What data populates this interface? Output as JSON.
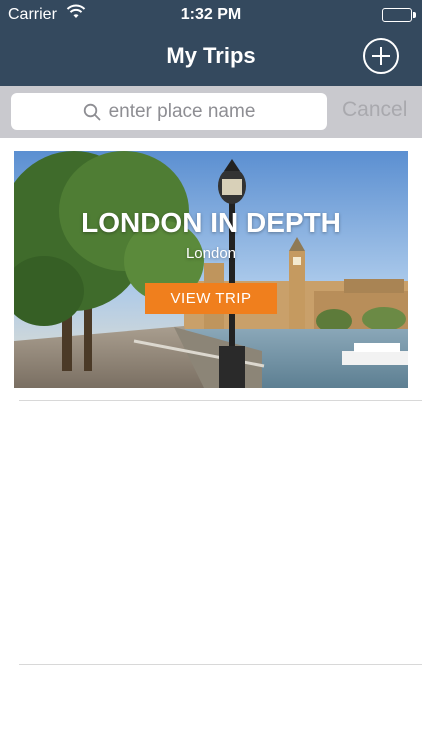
{
  "status_bar": {
    "carrier": "Carrier",
    "time": "1:32 PM"
  },
  "nav": {
    "title": "My Trips",
    "add_icon": "plus-circle-icon"
  },
  "search": {
    "placeholder": "enter place name",
    "cancel_label": "Cancel"
  },
  "trips": [
    {
      "title": "LONDON IN DEPTH",
      "subtitle": "London",
      "button_label": "VIEW TRIP"
    }
  ],
  "colors": {
    "navbar": "#34495e",
    "accent": "#f07f1d",
    "search_bg": "#c9c9ce"
  }
}
